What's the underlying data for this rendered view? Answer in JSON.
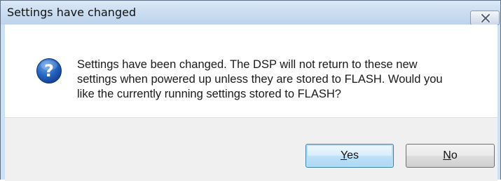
{
  "dialog": {
    "title": "Settings have changed",
    "message": "Settings have been changed. The DSP will not return to these new\nsettings when powered up unless they are stored to FLASH. Would you\nlike the currently running settings stored to FLASH?",
    "icon": "question-icon",
    "buttons": {
      "yes": {
        "mnemonic": "Y",
        "rest": "es"
      },
      "no": {
        "mnemonic": "N",
        "rest": "o"
      }
    },
    "colors": {
      "accent": "#3c7fb1",
      "icon_blue": "#1d5fb5"
    }
  }
}
